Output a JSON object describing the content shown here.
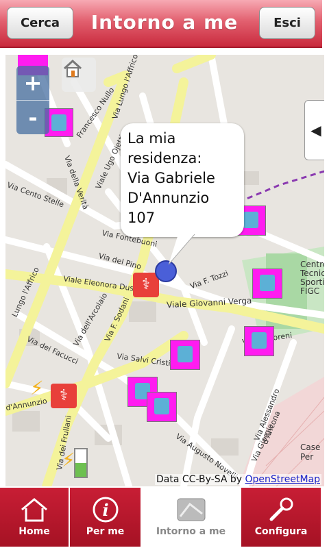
{
  "header": {
    "title": "Intorno a me",
    "left_button": "Cerca",
    "right_button": "Esci"
  },
  "map": {
    "bubble_lines": [
      "La mia",
      "residenza:",
      "Via Gabriele",
      "D'Annunzio",
      "107"
    ],
    "zoom_in": "+",
    "zoom_out": "-",
    "attribution_prefix": "Data CC-By-SA by ",
    "attribution_link": "OpenStreetMap",
    "street_labels": [
      "Francesco Nullo",
      "Via Lungo l'Affrico",
      "Viale Ugo Ojetti",
      "Via della Verità",
      "Via Cento Stelle",
      "Via Fontebuoni",
      "Via del Pino",
      "Viale Eleonora Duse",
      "Via F. Tozzi",
      "Viale Giovanni Verga",
      "Via dell'Arcolaio",
      "Via F. Sodani",
      "Via dei Facucci",
      "Via Salvi Cristiani",
      "Via D. Moreni",
      "Via Alessandro d'Ancona",
      "Via dei Frullani",
      "Via Augusto Novelli",
      "Via Giorgio",
      "Centro Tecnico Sportivo FIGC",
      "Case Per",
      "d'Annunzio",
      "Lungo l'Affrico"
    ]
  },
  "tabs": [
    {
      "label": "Home",
      "icon": "home-icon"
    },
    {
      "label": "Per me",
      "icon": "info-icon"
    },
    {
      "label": "Intorno a me",
      "icon": "map-icon",
      "selected": true
    },
    {
      "label": "Configura",
      "icon": "wrench-icon"
    }
  ],
  "colors": {
    "brand": "#c81e35",
    "poi_water": "#ff1cf0",
    "poi_medical": "#e8403a"
  }
}
